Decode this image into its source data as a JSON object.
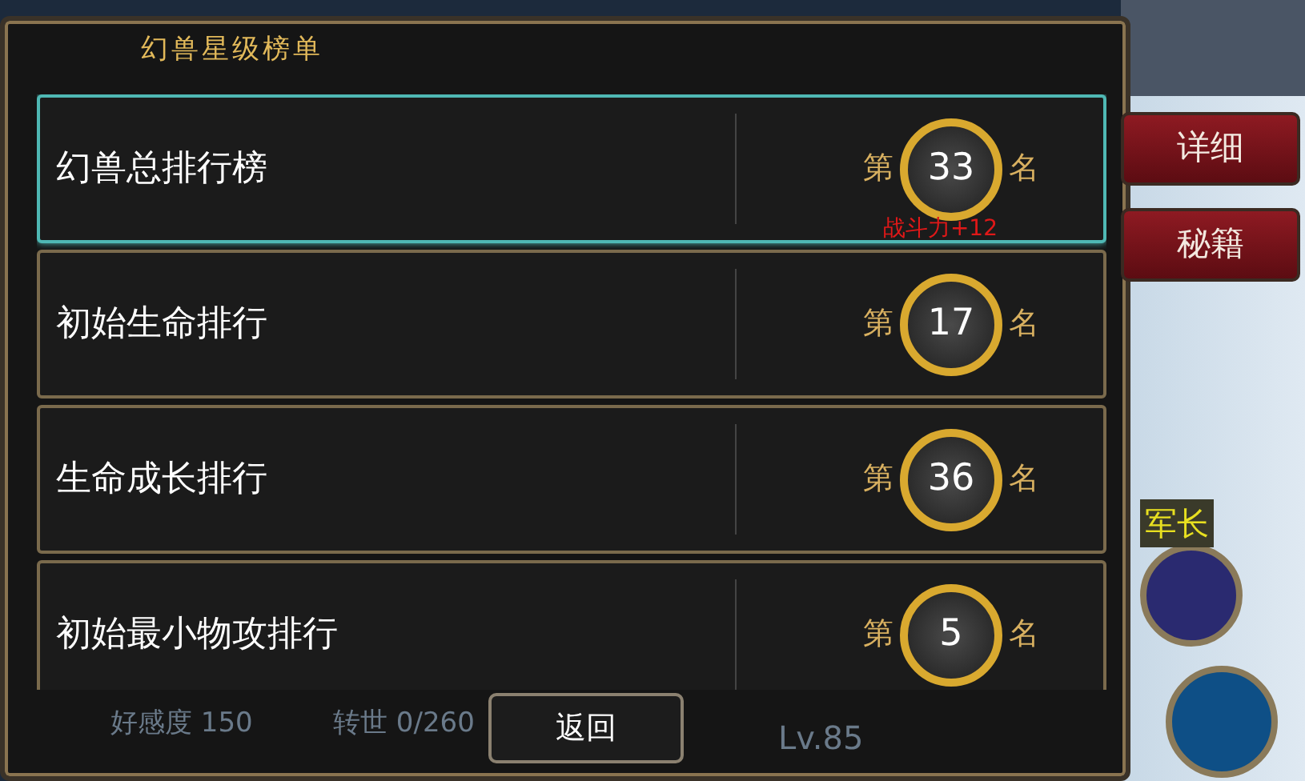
{
  "dialog": {
    "title": "幻兽星级榜单",
    "rows": [
      {
        "label": "幻兽总排行榜",
        "prefix": "第",
        "rank": "33",
        "suffix": "名",
        "bonus": "战斗力+12",
        "selected": true
      },
      {
        "label": "初始生命排行",
        "prefix": "第",
        "rank": "17",
        "suffix": "名",
        "selected": false
      },
      {
        "label": "生命成长排行",
        "prefix": "第",
        "rank": "36",
        "suffix": "名",
        "selected": false
      },
      {
        "label": "初始最小物攻排行",
        "prefix": "第",
        "rank": "5",
        "suffix": "名",
        "selected": false
      }
    ],
    "back_button": "返回"
  },
  "side_buttons": [
    "详细",
    "秘籍"
  ],
  "background": {
    "affection": "好感度 150",
    "rebirth": "转世 0/260",
    "level": "Lv.85",
    "banner": "军长"
  }
}
